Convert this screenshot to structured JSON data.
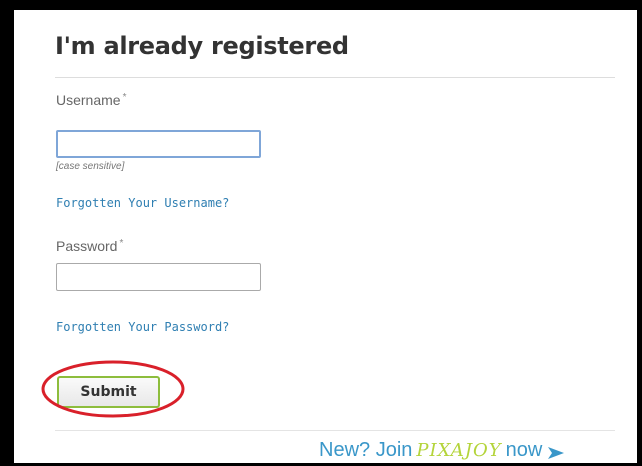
{
  "form": {
    "heading": "I'm already registered",
    "username": {
      "label": "Username",
      "required_mark": "*",
      "value": "",
      "hint": "[case sensitive]",
      "forgot_link": "Forgotten Your Username?"
    },
    "password": {
      "label": "Password",
      "required_mark": "*",
      "value": "",
      "forgot_link": "Forgotten Your Password?"
    },
    "submit_label": "Submit"
  },
  "footer": {
    "join_prefix": "New? Join",
    "brand_name": "PIXAJOY",
    "join_suffix": "now",
    "arrow_icon": "arrow-right-icon"
  },
  "colors": {
    "link": "#2f7fb2",
    "submit_border": "#8dbd3c",
    "annotation": "#d9202a",
    "brand_green": "#b4d43a",
    "brand_pink": "#e0529c"
  }
}
